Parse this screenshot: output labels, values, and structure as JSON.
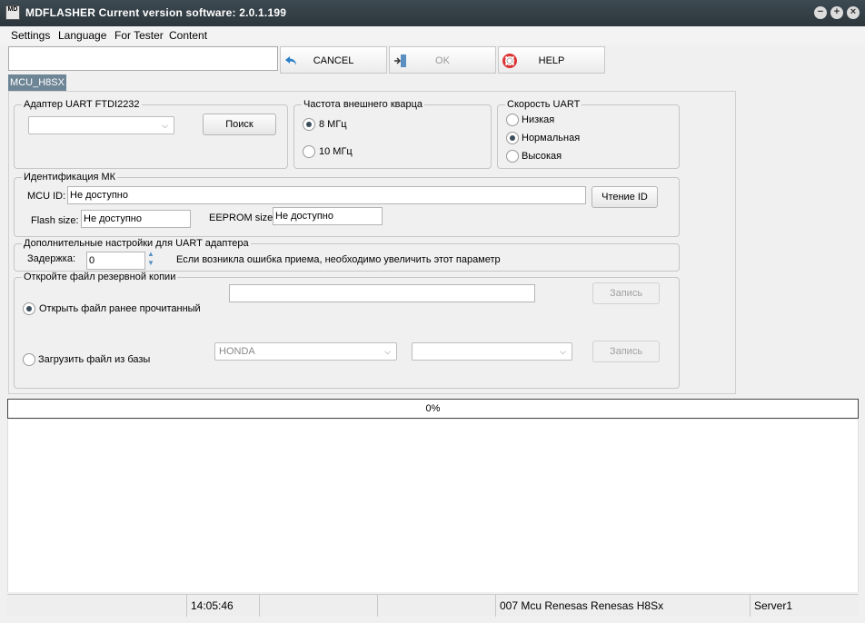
{
  "window": {
    "icon_text": "MD",
    "title": "MDFLASHER  Current version software: 2.0.1.199"
  },
  "menu": [
    "Settings",
    "Language",
    "For Tester",
    "Content"
  ],
  "toolbar": {
    "input_value": "",
    "cancel": "CANCEL",
    "ok": "OK",
    "help": "HELP"
  },
  "tab": "MCU_H8SX",
  "uart_adapter": {
    "title": "Адаптер UART FTDI2232",
    "select_value": "",
    "search_button": "Поиск"
  },
  "crystal": {
    "title": "Частота внешнего кварца",
    "options": [
      "8 МГц",
      "10 МГц"
    ],
    "selected": 0
  },
  "uart_speed": {
    "title": "Скорость UART",
    "options": [
      "Низкая",
      "Нормальная",
      "Высокая"
    ],
    "selected": 1
  },
  "mcu_id": {
    "title": "Идентификация МК",
    "mcu_id_label": "MCU ID:",
    "mcu_id_value": "Не доступно",
    "read_id_button": "Чтение ID",
    "flash_label": "Flash size:",
    "flash_value": "Не доступно",
    "eeprom_label": "EEPROM size:",
    "eeprom_value": "Не доступно"
  },
  "extra": {
    "title": "Дополнительные настройки для UART адаптера",
    "delay_label": "Задержка:",
    "delay_value": "0",
    "hint": "Если возникла ошибка приема, необходимо увеличить этот параметр"
  },
  "backup": {
    "title": "Откройте файл резервной копии",
    "open_prev": "Открыть файл ранее прочитанный",
    "load_db": "Загрузить файл из базы",
    "file_path": "",
    "write_button": "Запись",
    "brand_value": "HONDA",
    "model_value": "",
    "write_button2": "Запись",
    "selected": 0
  },
  "progress": "0%",
  "status": {
    "time": "14:05:46",
    "mcu": "007 Mcu Renesas Renesas H8Sx",
    "server": "Server1"
  }
}
